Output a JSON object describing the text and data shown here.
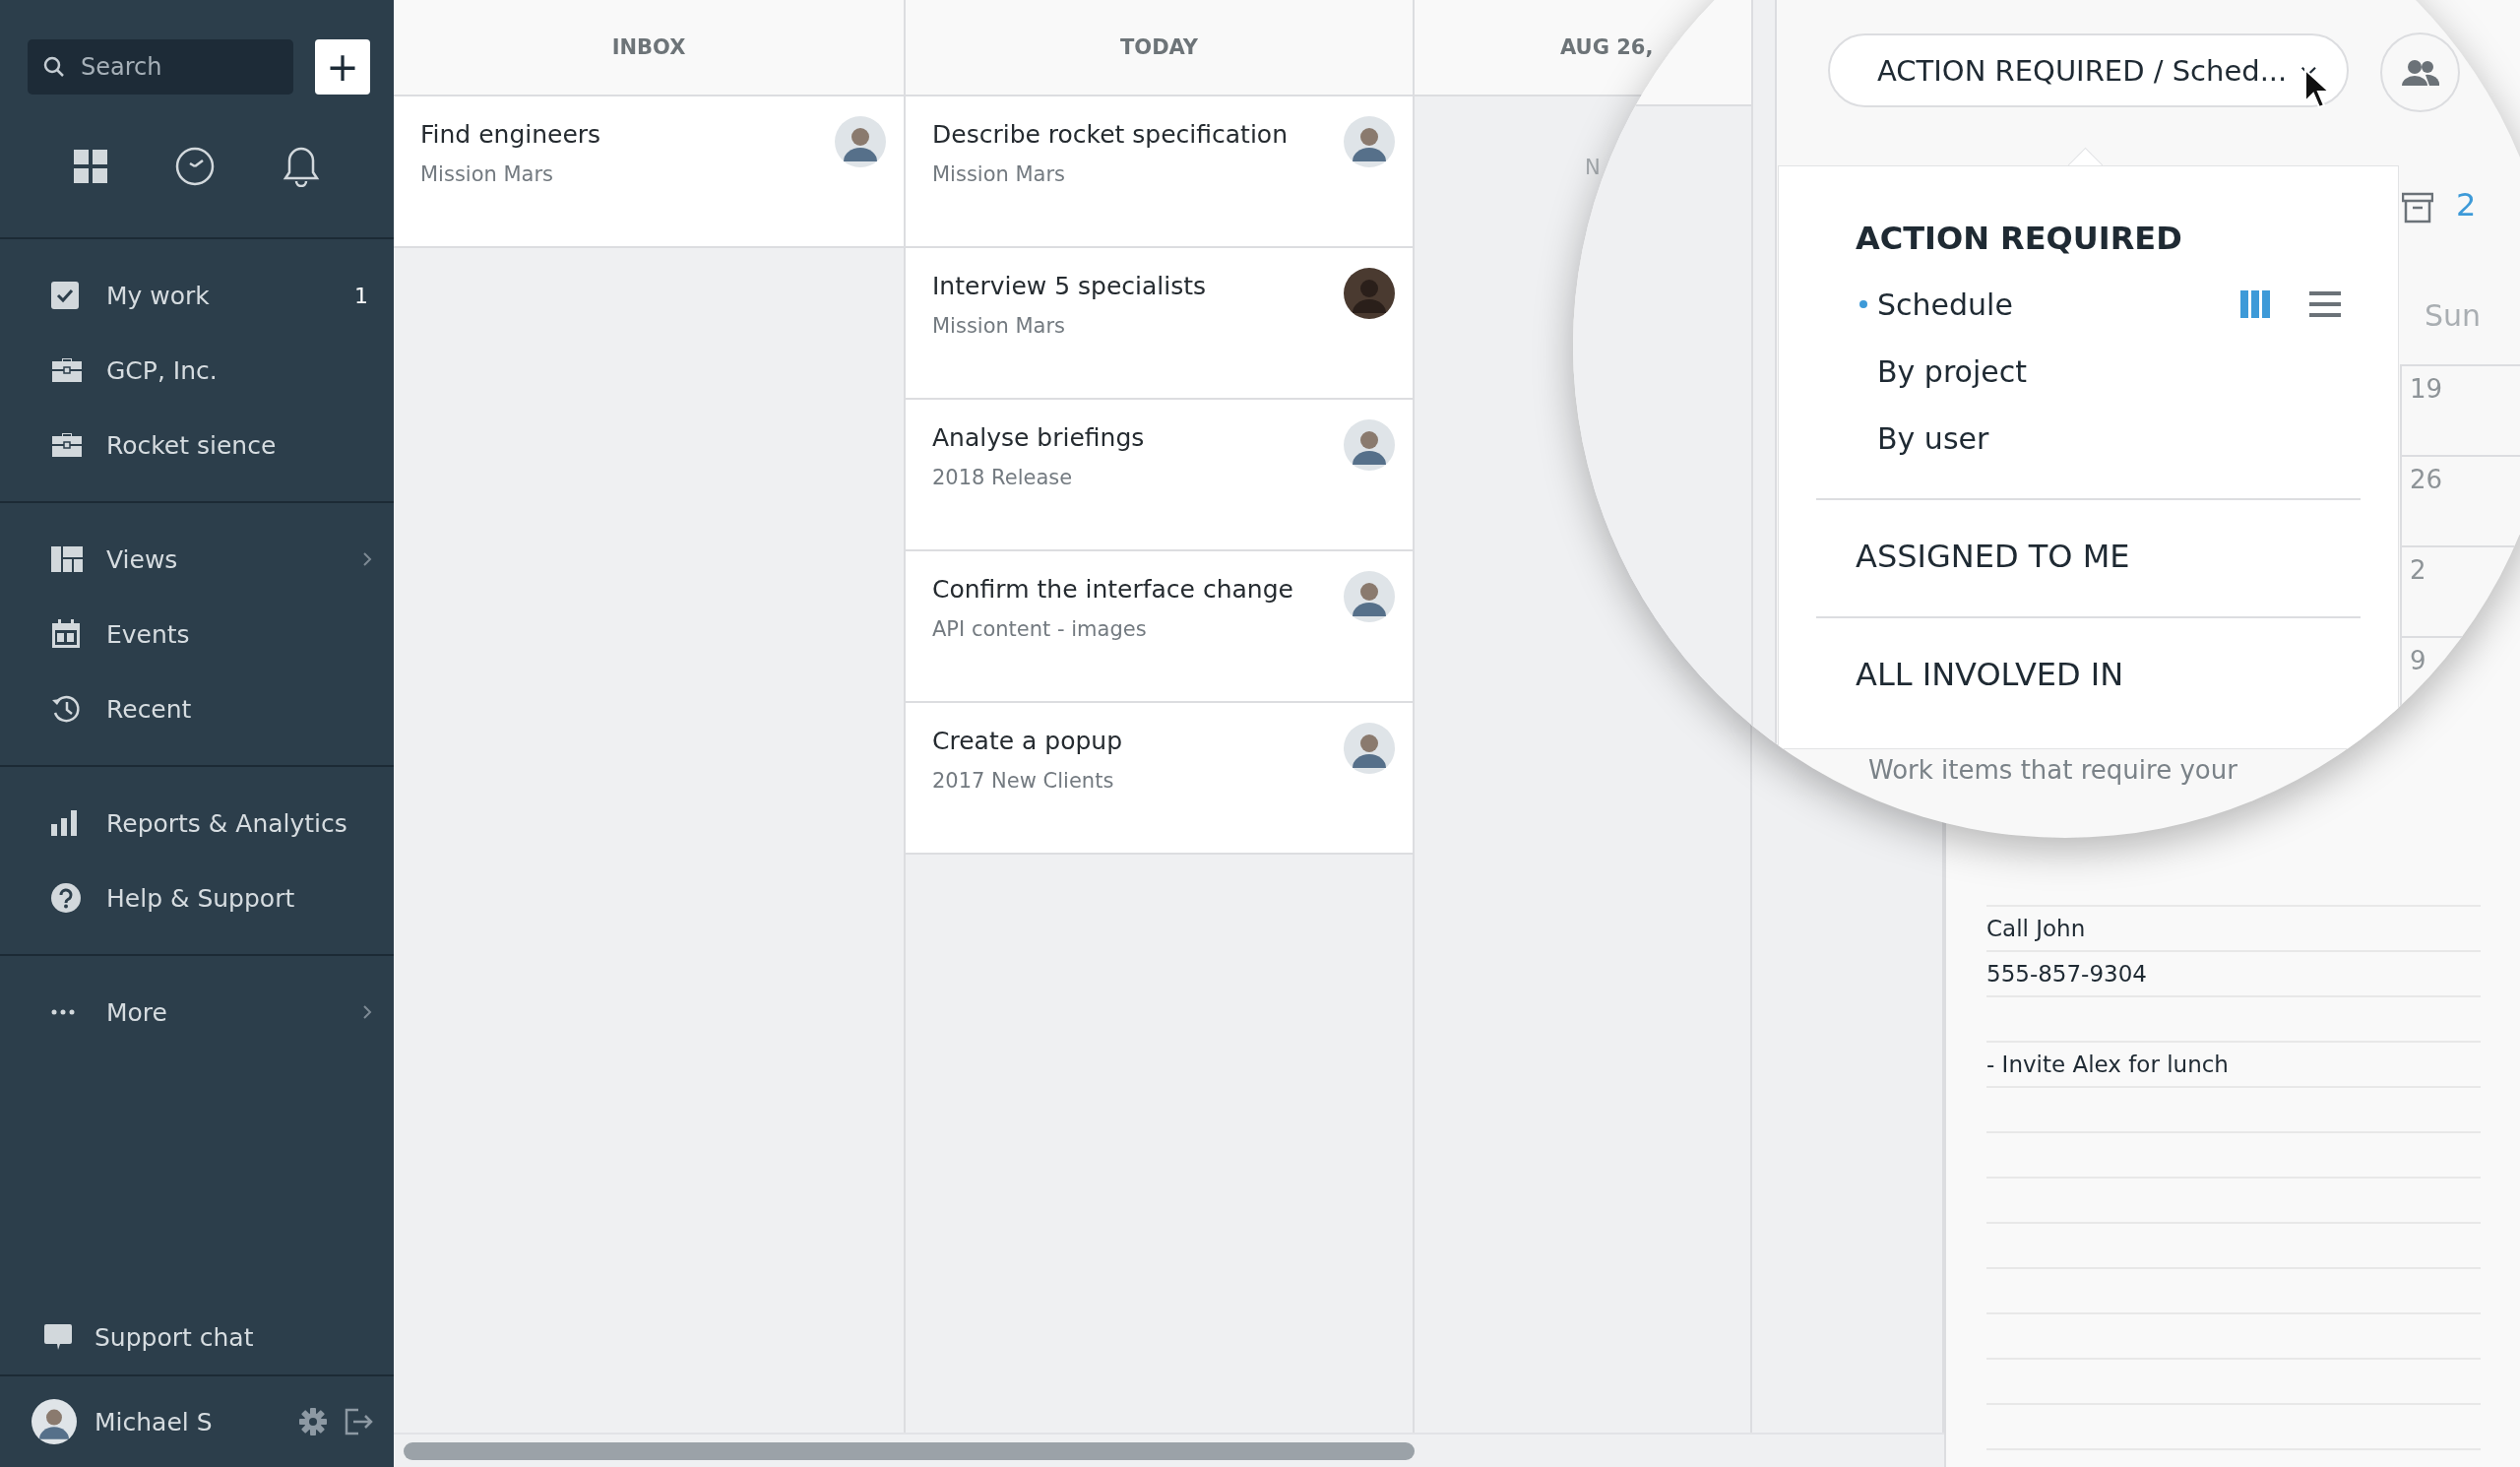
{
  "sidebar": {
    "search": {
      "placeholder": "Search"
    },
    "add_button": "+",
    "sections": [
      {
        "items": [
          {
            "label": "My work",
            "badge": "1",
            "submenu": false
          },
          {
            "label": "GCP, Inc.",
            "submenu": false
          },
          {
            "label": "Rocket sience",
            "submenu": false
          }
        ]
      },
      {
        "items": [
          {
            "label": "Views",
            "submenu": true
          },
          {
            "label": "Events",
            "submenu": false
          },
          {
            "label": "Recent",
            "submenu": false
          }
        ]
      },
      {
        "items": [
          {
            "label": "Reports & Analytics",
            "submenu": false
          },
          {
            "label": "Help & Support",
            "submenu": false
          }
        ]
      },
      {
        "items": [
          {
            "label": "More",
            "submenu": true
          }
        ]
      }
    ],
    "support_chat": "Support chat",
    "user": {
      "name": "Michael S"
    }
  },
  "board": {
    "columns": [
      {
        "title": "INBOX",
        "cards": [
          {
            "title": "Find engineers",
            "project": "Mission Mars"
          }
        ]
      },
      {
        "title": "TODAY",
        "cards": [
          {
            "title": "Describe rocket specification",
            "project": "Mission Mars"
          },
          {
            "title": "Interview 5 specialists",
            "project": "Mission Mars"
          },
          {
            "title": "Analyse briefings",
            "project": "2018 Release"
          },
          {
            "title": "Confirm the interface change",
            "project": "API content - images"
          },
          {
            "title": "Create a popup",
            "project": "2017 New Clients"
          }
        ]
      },
      {
        "title": "AUG 26,",
        "empty_text": "N"
      }
    ]
  },
  "notes": {
    "lines": [
      {
        "text": "Call John",
        "gap_before": false
      },
      {
        "text": "555-857-9304",
        "gap_before": false
      },
      {
        "text": "- Invite Alex for lunch",
        "gap_before": true
      }
    ]
  },
  "magnifier": {
    "view_button": "ACTION REQUIRED / Sched...",
    "archive_count": "2",
    "day_header": "Sun",
    "dates": [
      "19",
      "26",
      "2",
      "9"
    ],
    "menu": {
      "sections": [
        {
          "title": "ACTION REQUIRED",
          "selected": true,
          "items": [
            {
              "label": "Schedule",
              "selected": true
            },
            {
              "label": "By project",
              "selected": false
            },
            {
              "label": "By user",
              "selected": false
            }
          ]
        },
        {
          "title": "ASSIGNED TO ME",
          "selected": false
        },
        {
          "title": "ALL INVOLVED IN",
          "selected": false
        }
      ]
    },
    "view_modes": [
      {
        "kind": "columns",
        "selected": true
      },
      {
        "kind": "list",
        "selected": false
      }
    ],
    "hint": "Work items that require your"
  }
}
